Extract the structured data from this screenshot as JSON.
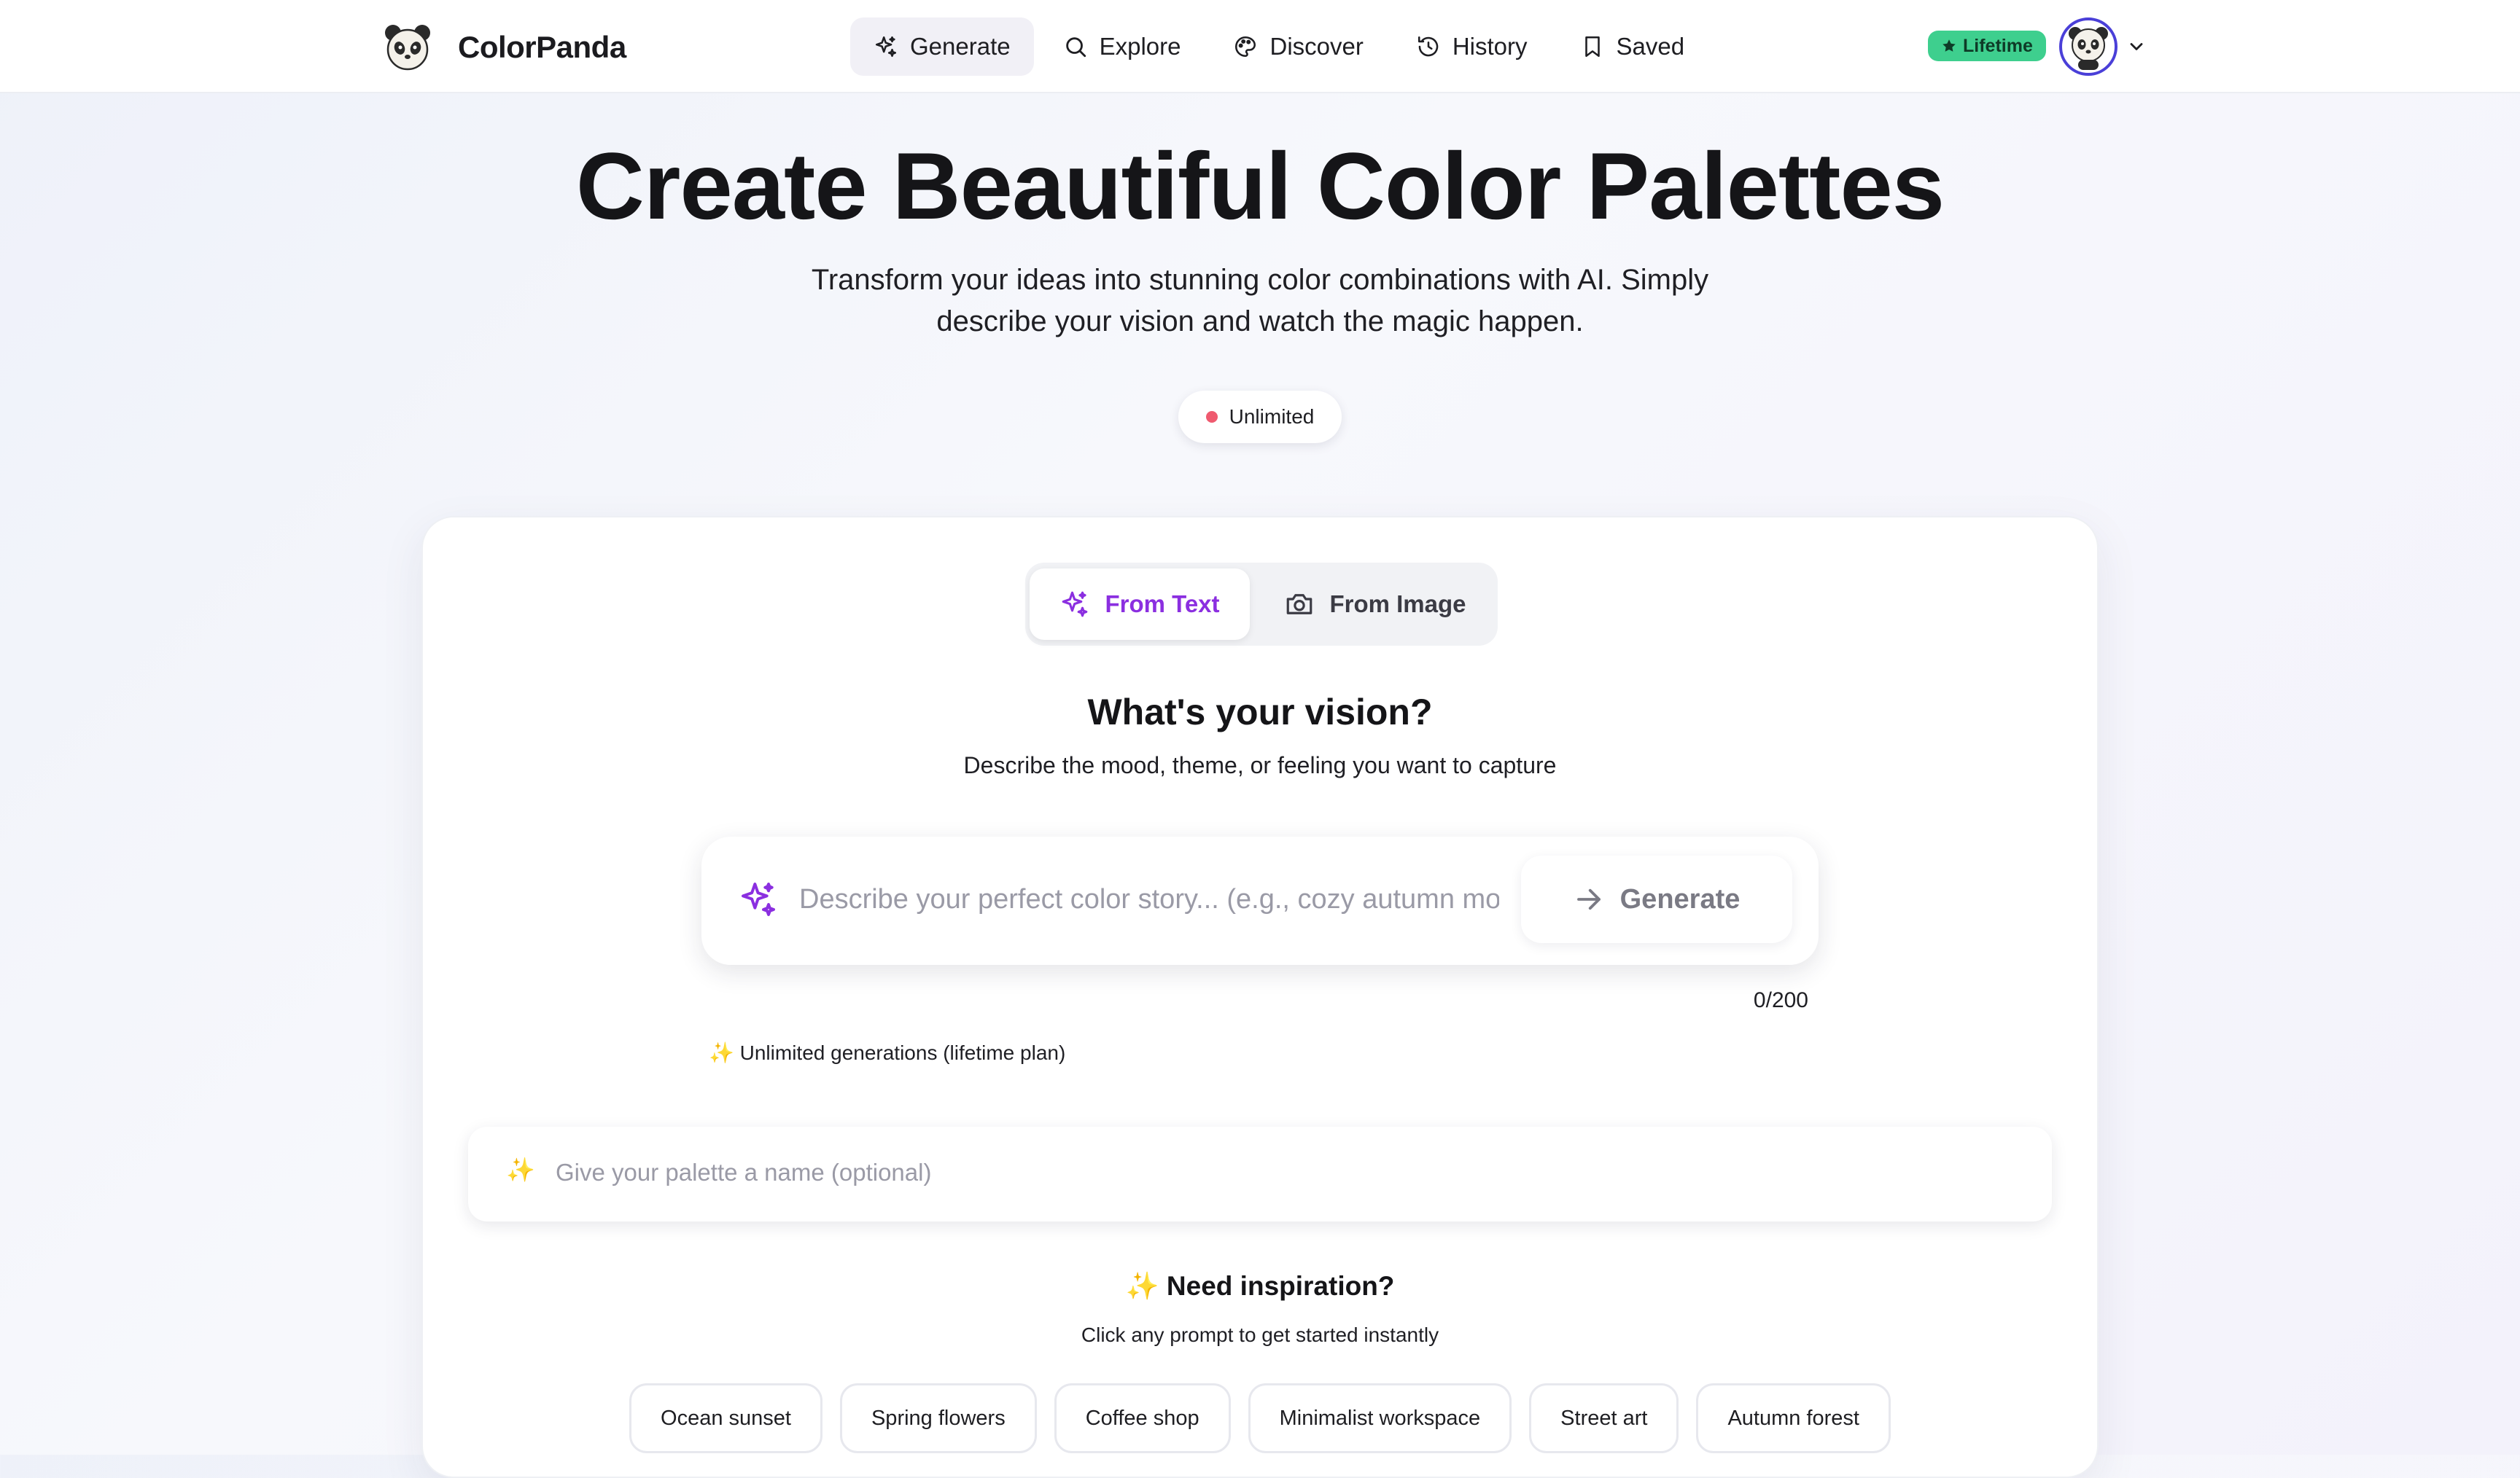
{
  "header": {
    "brand_name": "ColorPanda",
    "nav": [
      {
        "label": "Generate",
        "icon": "sparkles-icon",
        "active": true
      },
      {
        "label": "Explore",
        "icon": "search-icon",
        "active": false
      },
      {
        "label": "Discover",
        "icon": "palette-icon",
        "active": false
      },
      {
        "label": "History",
        "icon": "history-icon",
        "active": false
      },
      {
        "label": "Saved",
        "icon": "bookmark-icon",
        "active": false
      }
    ],
    "plan_badge": "Lifetime"
  },
  "hero": {
    "title": "Create Beautiful Color Palettes",
    "subtitle": "Transform your ideas into stunning color combinations with AI. Simply describe your vision and watch the magic happen.",
    "status_pill": "Unlimited"
  },
  "mode_toggle": {
    "text_label": "From Text",
    "image_label": "From Image",
    "active": "text"
  },
  "vision": {
    "title": "What's your vision?",
    "subtitle": "Describe the mood, theme, or feeling you want to capture"
  },
  "prompt": {
    "placeholder": "Describe your perfect color story... (e.g., cozy autumn morning)",
    "value": "",
    "char_count": "0/200",
    "generate_label": "Generate"
  },
  "plan_note": "✨ Unlimited generations (lifetime plan)",
  "name_field": {
    "icon": "✨",
    "placeholder": "Give your palette a name (optional)",
    "value": ""
  },
  "inspiration": {
    "title": "✨ Need inspiration?",
    "subtitle": "Click any prompt to get started instantly",
    "prompts": [
      "Ocean sunset",
      "Spring flowers",
      "Coffee shop",
      "Minimalist workspace",
      "Street art",
      "Autumn forest"
    ]
  },
  "colors": {
    "accent_purple": "#8b2fe0",
    "badge_green": "#3ecf8e",
    "status_red": "#ef5a6f",
    "avatar_ring": "#4a3fd8"
  }
}
